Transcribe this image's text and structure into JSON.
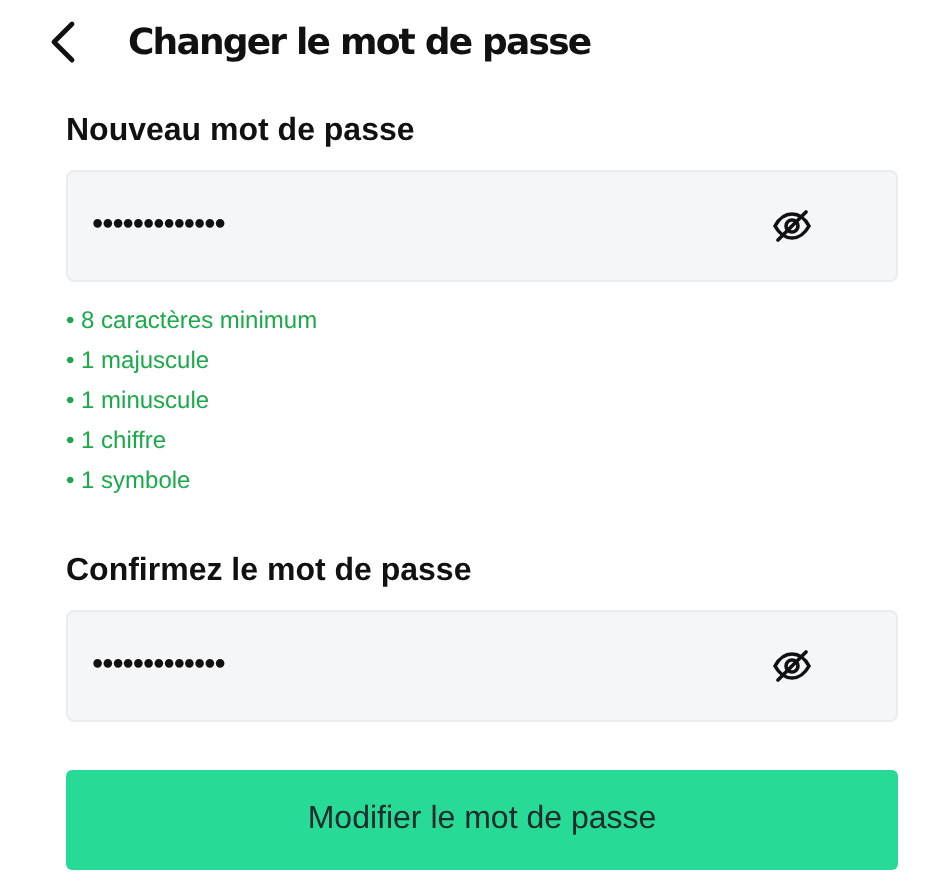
{
  "header": {
    "title": "Changer le mot de passe"
  },
  "new_password": {
    "label": "Nouveau mot de passe",
    "value": "•••••••••••••",
    "masked": true
  },
  "rules": [
    {
      "text": "• 8 caractères minimum",
      "met": true
    },
    {
      "text": "• 1 majuscule",
      "met": true
    },
    {
      "text": "• 1 minuscule",
      "met": true
    },
    {
      "text": "• 1 chiffre",
      "met": true
    },
    {
      "text": "• 1 symbole",
      "met": true
    }
  ],
  "confirm_password": {
    "label": "Confirmez le mot de passe",
    "value": "•••••••••••••",
    "masked": true
  },
  "submit": {
    "label": "Modifier le mot de passe"
  }
}
